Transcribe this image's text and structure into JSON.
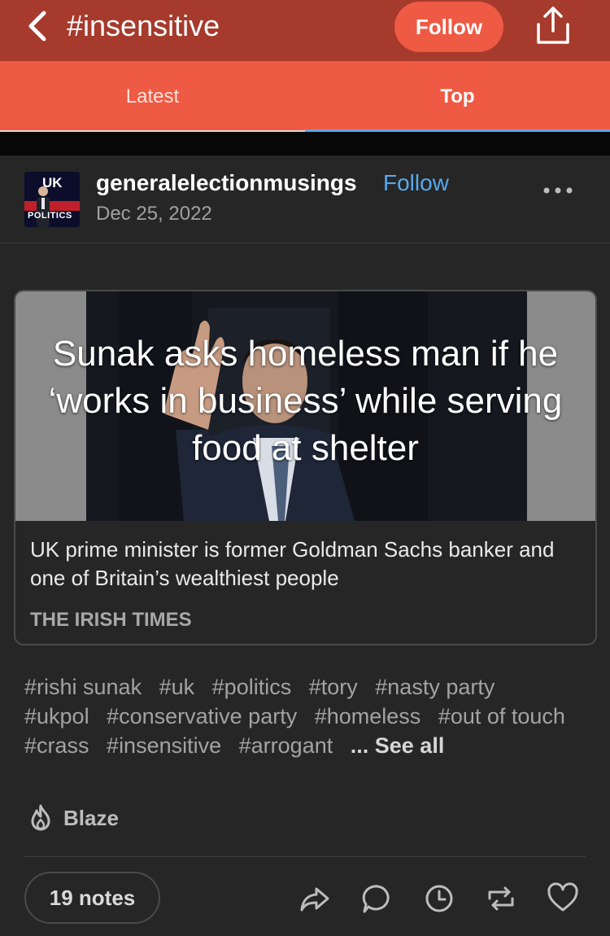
{
  "header": {
    "title": "#insensitive",
    "follow_label": "Follow",
    "back_icon": "chevron-left-icon",
    "share_icon": "share-icon",
    "colors": {
      "bar": "#a63a2c",
      "accent": "#ee5a43"
    }
  },
  "tabs": [
    {
      "label": "Latest",
      "active": false
    },
    {
      "label": "Top",
      "active": true
    }
  ],
  "post": {
    "avatar": {
      "line1": "UK",
      "line2": "POLITICS"
    },
    "blog_name": "generalelectionmusings",
    "follow_label": "Follow",
    "date": "Dec 25, 2022",
    "link_card": {
      "headline": "Sunak asks homeless man if he ‘works in business’ while serving food at shelter",
      "description": "UK prime minister is former Goldman Sachs banker and one of Britain’s wealthiest people",
      "source": "THE IRISH TIMES"
    },
    "tags": [
      "#rishi sunak",
      "#uk",
      "#politics",
      "#tory",
      "#nasty party",
      "#ukpol",
      "#conservative party",
      "#homeless",
      "#out of touch",
      "#crass",
      "#insensitive",
      "#arrogant"
    ],
    "see_all_label": "... See all",
    "blaze_label": "Blaze",
    "notes_label": "19 notes",
    "actions": [
      "share-icon",
      "reply-icon",
      "schedule-icon",
      "reblog-icon",
      "like-icon"
    ]
  }
}
